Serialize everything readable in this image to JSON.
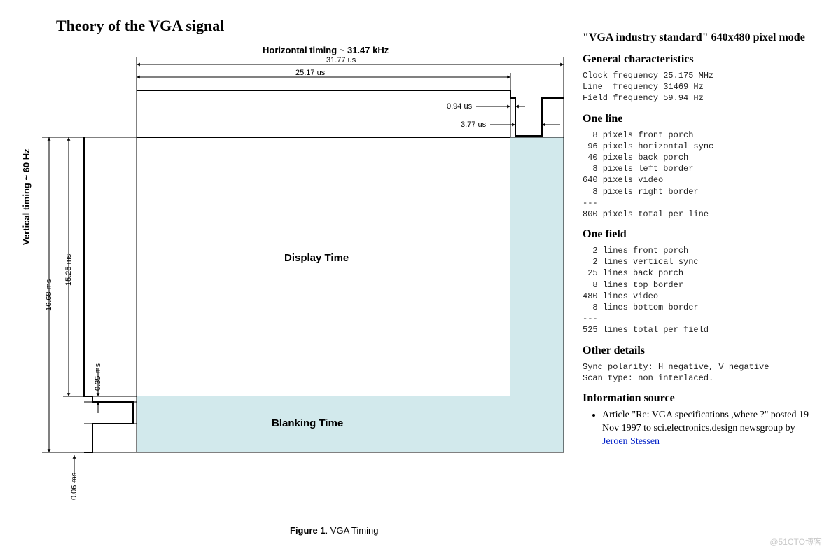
{
  "title": "Theory  of the VGA signal",
  "diagram": {
    "horizontal_title": "Horizontal timing ~ 31.47 kHz",
    "vertical_title": "Vertical timing ~ 60 Hz",
    "h_total": "31.77 us",
    "h_active": "25.17 us",
    "h_front_porch": "0.94 us",
    "h_sync": "3.77 us",
    "v_total": "16.68 ms",
    "v_active": "15.25 ms",
    "v_front_porch": "0.35 ms",
    "v_sync": "0.06 ms",
    "display_label": "Display Time",
    "blanking_label": "Blanking Time",
    "fig_num": "Figure 1",
    "fig_title": ". VGA Timing"
  },
  "spec": {
    "title": "\"VGA industry standard\" 640x480 pixel mode",
    "section_general": "General characteristics",
    "general_lines": "Clock frequency 25.175 MHz\nLine  frequency 31469 Hz\nField frequency 59.94 Hz",
    "section_line": "One line",
    "line_lines": "  8 pixels front porch\n 96 pixels horizontal sync\n 40 pixels back porch\n  8 pixels left border\n640 pixels video\n  8 pixels right border\n---\n800 pixels total per line",
    "section_field": "One field",
    "field_lines": "  2 lines front porch\n  2 lines vertical sync\n 25 lines back porch\n  8 lines top border\n480 lines video\n  8 lines bottom border\n---\n525 lines total per field",
    "section_other": "Other details",
    "other_lines": "Sync polarity: H negative, V negative\nScan type: non interlaced.",
    "section_info": "Information source",
    "info_text_a": "Article \"Re: VGA specifications ,where ?\" posted 19 Nov 1997 to sci.electronics.design newsgroup by ",
    "info_link": "Jeroen Stessen"
  },
  "watermark": "@51CTO博客"
}
